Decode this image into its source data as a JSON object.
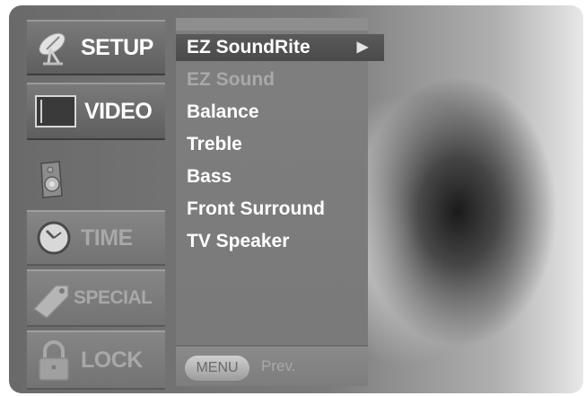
{
  "sidebar": {
    "setup": "SETUP",
    "video": "VIDEO",
    "time": "TIME",
    "special": "SPECIAL",
    "lock": "LOCK"
  },
  "menu": {
    "items": [
      {
        "label": "EZ SoundRite",
        "state": "selected",
        "arrow": "▶"
      },
      {
        "label": "EZ Sound",
        "state": "disabled"
      },
      {
        "label": "Balance",
        "state": "normal"
      },
      {
        "label": "Treble",
        "state": "normal"
      },
      {
        "label": "Bass",
        "state": "normal"
      },
      {
        "label": "Front Surround",
        "state": "normal"
      },
      {
        "label": "TV Speaker",
        "state": "normal"
      }
    ]
  },
  "footer": {
    "menu_button": "MENU",
    "prev_label": "Prev."
  },
  "colors": {
    "panel": "#7f7f7f",
    "highlight": "#4f4f4f",
    "text": "#ffffff",
    "dim_text": "#a9a9a9"
  }
}
